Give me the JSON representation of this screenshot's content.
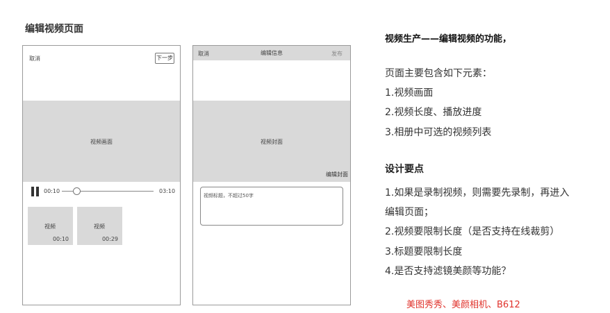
{
  "page_title": "编辑视频页面",
  "screen1": {
    "cancel": "取消",
    "next": "下一步",
    "video_placeholder": "视频画面",
    "time_current": "00:10",
    "time_total": "03:10",
    "progress_fraction": 0.16,
    "thumbnails": [
      {
        "label": "视频",
        "duration": "00:10"
      },
      {
        "label": "视频",
        "duration": "00:29"
      }
    ]
  },
  "screen2": {
    "cancel": "取消",
    "title": "编辑信息",
    "publish": "发布",
    "cover_placeholder": "视频封面",
    "edit_cover": "编辑封面",
    "title_placeholder": "视频标题，不超过50字"
  },
  "notes": {
    "heading": "视频生产——编辑视频的功能，",
    "intro": "页面主要包含如下元素：",
    "elements": [
      "1.视频画面",
      "2.视频长度、播放进度",
      "3.相册中可选的视频列表"
    ],
    "design_heading": "设计要点",
    "design_points": [
      "1.如果是录制视频，则需要先录制，再进入",
      "编辑页面；",
      "2.视频要限制长度（是否支持在线裁剪）",
      "3.标题要限制长度",
      "4.是否支持滤镜美颜等功能？"
    ],
    "apps": "美图秀秀、美颜相机、B612",
    "apps_color": "#e0322b"
  }
}
